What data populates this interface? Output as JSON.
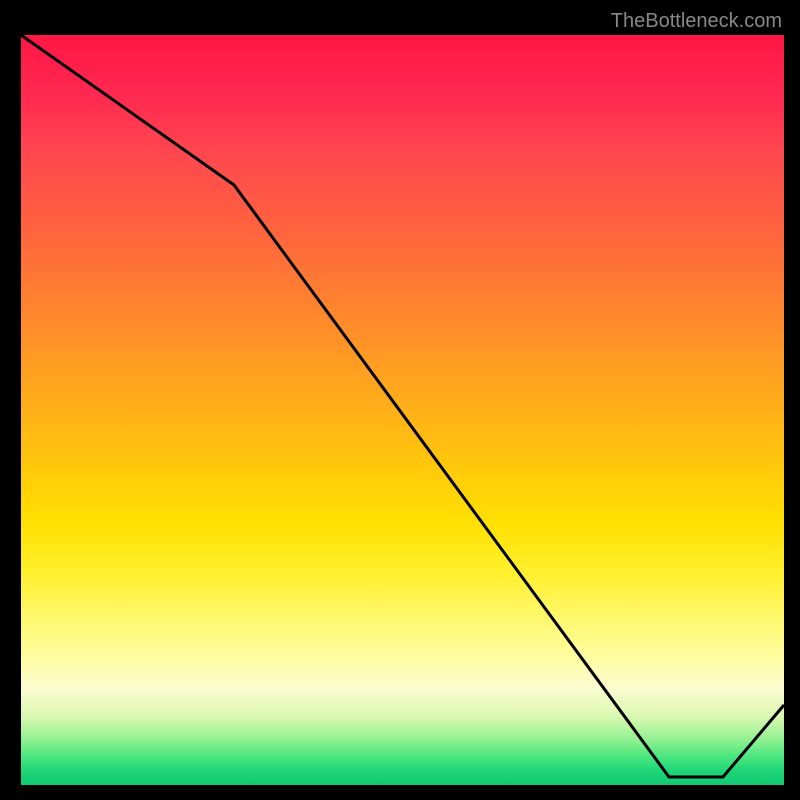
{
  "watermark": "TheBottleneck.com",
  "label_text": "",
  "chart_data": {
    "type": "line",
    "title": "",
    "xlabel": "",
    "ylabel": "",
    "x": [
      0,
      28,
      85,
      92,
      100
    ],
    "values": [
      100,
      80,
      0,
      0,
      10
    ],
    "ylim": [
      0,
      100
    ],
    "xlim": [
      0,
      100
    ],
    "annotations": [
      {
        "text": "",
        "x": 88,
        "y": 1
      }
    ],
    "watermark": "TheBottleneck.com",
    "background": "rainbow-gradient-red-to-green"
  }
}
